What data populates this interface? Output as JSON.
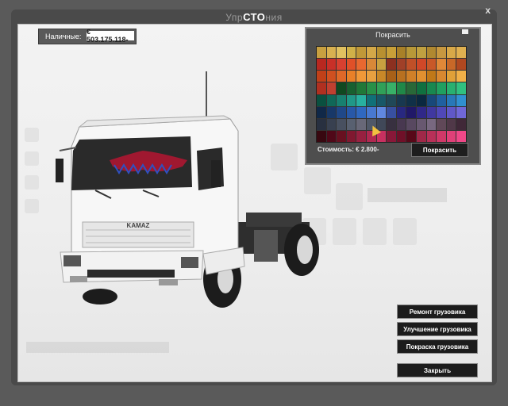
{
  "window": {
    "title_prefix": "Упр",
    "title_strong": "СТО",
    "title_suffix": "ния",
    "close_glyph": "x"
  },
  "cash": {
    "label": "Наличные:",
    "value": "€ 503.175.118-"
  },
  "paint_dialog": {
    "title": "Покрасить",
    "cost_label": "Стоимость: € 2.800-",
    "button": "Покрасить",
    "palette_rows": [
      [
        "#c8a040",
        "#d8b050",
        "#e0c060",
        "#d0b048",
        "#c09838",
        "#d4a848",
        "#b89030",
        "#c8a038",
        "#a88028",
        "#b89838",
        "#c0a040",
        "#b08830",
        "#c89840",
        "#d8a848",
        "#e0b050"
      ],
      [
        "#b82820",
        "#c83028",
        "#d84030",
        "#e05028",
        "#e86830",
        "#d88838",
        "#c8a040",
        "#8c3020",
        "#a04028",
        "#c05028",
        "#d04828",
        "#c85828",
        "#e08838",
        "#c86828",
        "#b04820"
      ],
      [
        "#c04018",
        "#d05020",
        "#e06828",
        "#e88028",
        "#f09838",
        "#e8a040",
        "#c88828",
        "#a86018",
        "#b87020",
        "#d08028",
        "#e09030",
        "#c07818",
        "#d88830",
        "#e0a038",
        "#f0b048"
      ],
      [
        "#b03020",
        "#c04030",
        "#104820",
        "#186030",
        "#207838",
        "#289048",
        "#30a058",
        "#38b068",
        "#208848",
        "#286838",
        "#107040",
        "#188850",
        "#20a060",
        "#28b070",
        "#30c080"
      ],
      [
        "#0a5040",
        "#106858",
        "#188070",
        "#209888",
        "#28b0a0",
        "#107078",
        "#185868",
        "#204858",
        "#183850",
        "#103048",
        "#0a2840",
        "#18487a",
        "#2060a0",
        "#2878b8",
        "#3090d0"
      ],
      [
        "#102848",
        "#183868",
        "#204888",
        "#2858a8",
        "#3068c0",
        "#4878d0",
        "#6088e0",
        "#3850a0",
        "#282880",
        "#201868",
        "#302888",
        "#4038a0",
        "#5048b8",
        "#6058c8",
        "#7068d8"
      ],
      [
        "#283040",
        "#384050",
        "#485060",
        "#586070",
        "#686878",
        "#505868",
        "#404858",
        "#383040",
        "#483850",
        "#584860",
        "#685870",
        "#786880",
        "#604858",
        "#503848",
        "#402838"
      ],
      [
        "#380810",
        "#500818",
        "#681020",
        "#801830",
        "#982040",
        "#b02850",
        "#c83060",
        "#881838",
        "#701028",
        "#580818",
        "#a02848",
        "#b83058",
        "#d03868",
        "#e04078",
        "#f04888"
      ]
    ]
  },
  "actions": {
    "repair": "Ремонт грузовика",
    "upgrade": "Улучшение грузовика",
    "paint": "Покраска грузовика",
    "close": "Закрыть"
  },
  "truck": {
    "brand": "KAMAZ"
  }
}
